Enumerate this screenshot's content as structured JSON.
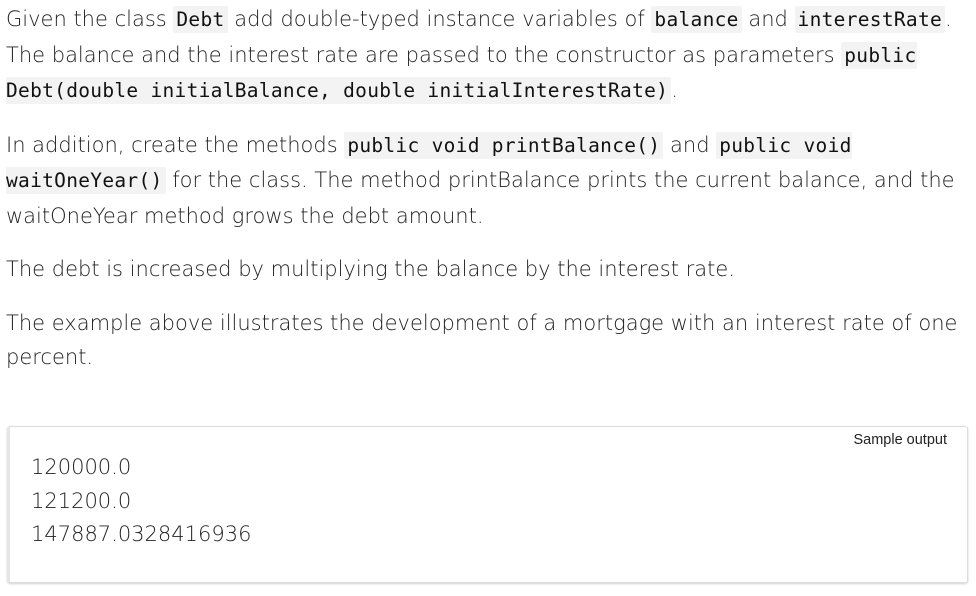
{
  "paragraph1": {
    "t1": "Given the class ",
    "c1": "Debt",
    "t2": " add double-typed instance variables of ",
    "c2": "balance",
    "t3": " and ",
    "c3": "interestRate",
    "t4": ". The balance and the interest rate are passed to the constructor as parameters ",
    "c4": "public Debt(double initialBalance, double initialInterestRate)",
    "t5": "."
  },
  "paragraph2": {
    "t1": "In addition, create the methods ",
    "c1": "public void printBalance()",
    "t2": " and ",
    "c2": "public void waitOneYear()",
    "t3": " for the class. The method printBalance prints the current balance, and the waitOneYear method grows the debt amount."
  },
  "paragraph3": "The debt is increased by multiplying the balance by the interest rate.",
  "paragraph4": "The example above illustrates the development of a mortgage with an interest rate of one percent.",
  "sample": {
    "label": "Sample output",
    "lines": [
      "120000.0",
      "121200.0",
      "147887.0328416936"
    ]
  }
}
